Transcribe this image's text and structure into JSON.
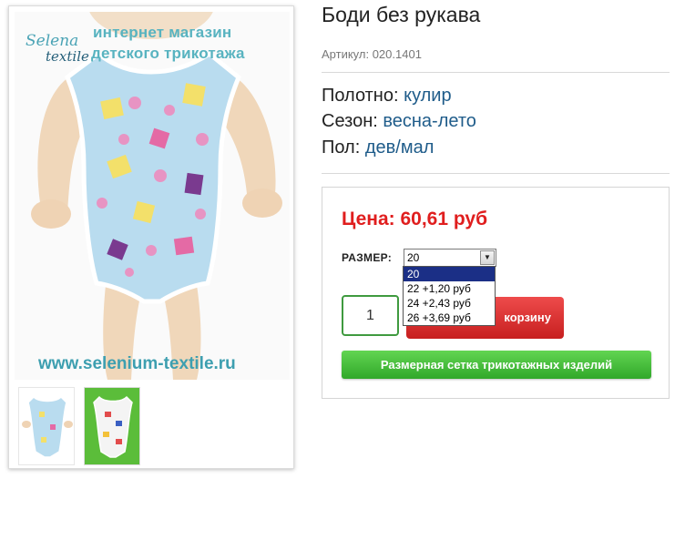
{
  "product": {
    "title": "Боди без рукава",
    "sku_label": "Артикул:",
    "sku": "020.1401"
  },
  "attributes": [
    {
      "label": "Полотно:",
      "value": "кулир"
    },
    {
      "label": "Сезон:",
      "value": "весна-лето"
    },
    {
      "label": "Пол:",
      "value": "дев/мал"
    }
  ],
  "gallery": {
    "watermark_line1": "интернет магазин",
    "watermark_line2": "детского трикотажа",
    "logo_top": "Selena",
    "logo_bottom": "textile",
    "site_url": "www.selenium-textile.ru"
  },
  "buy_box": {
    "price_label": "Цена:",
    "price_value": "60,61 руб",
    "size_label": "РАЗМЕР:",
    "size_selected": "20",
    "size_options": [
      "20",
      "22 +1,20 руб",
      "24 +2,43 руб",
      "26 +3,69 руб"
    ],
    "quantity": "1",
    "cart_button_label": "корзину",
    "size_grid_button_label": "Размерная сетка трикотажных изделий"
  },
  "colors": {
    "price": "#e01e1e",
    "attribute_value": "#1f5c8a",
    "cart_button": "#d62a2a",
    "size_grid_button": "#3fba33",
    "dropdown_highlight": "#1b2f86"
  }
}
